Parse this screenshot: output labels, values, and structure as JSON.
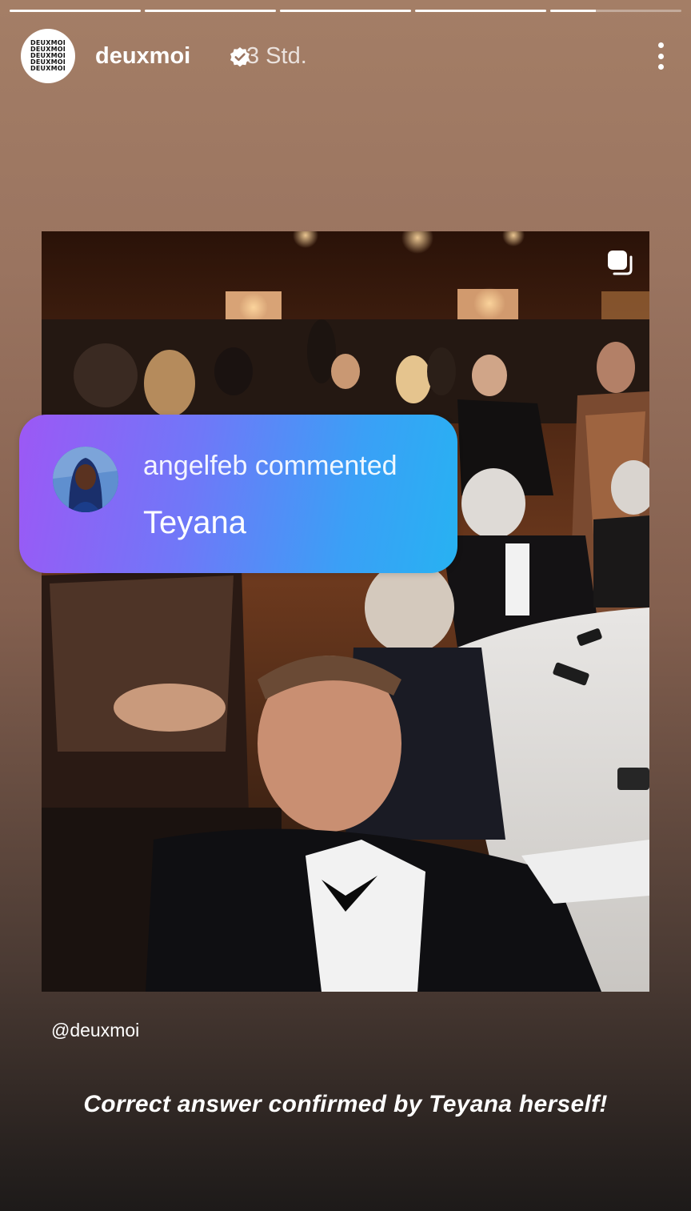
{
  "progress": {
    "segments": [
      1,
      1,
      1,
      1,
      0.35
    ]
  },
  "header": {
    "avatar_text": [
      "DEUXMOI",
      "DEUXMOI",
      "DEUXMOI",
      "DEUXMOI",
      "DEUXMOI"
    ],
    "username": "deuxmoi",
    "verified_icon": "verified-badge-icon",
    "time": "3 Std.",
    "menu_icon": "more-vertical-icon"
  },
  "media": {
    "multi_icon": "multiple-photos-icon"
  },
  "comment_sticker": {
    "heading": "angelfeb commented",
    "text": "Teyana"
  },
  "mention": "@deuxmoi",
  "caption": "Correct answer confirmed by Teyana herself!",
  "colors": {
    "sticker_start": "#9c58f5",
    "sticker_end": "#27b2f2",
    "background_top": "#a47e66",
    "background_bottom": "#1d1a19"
  }
}
